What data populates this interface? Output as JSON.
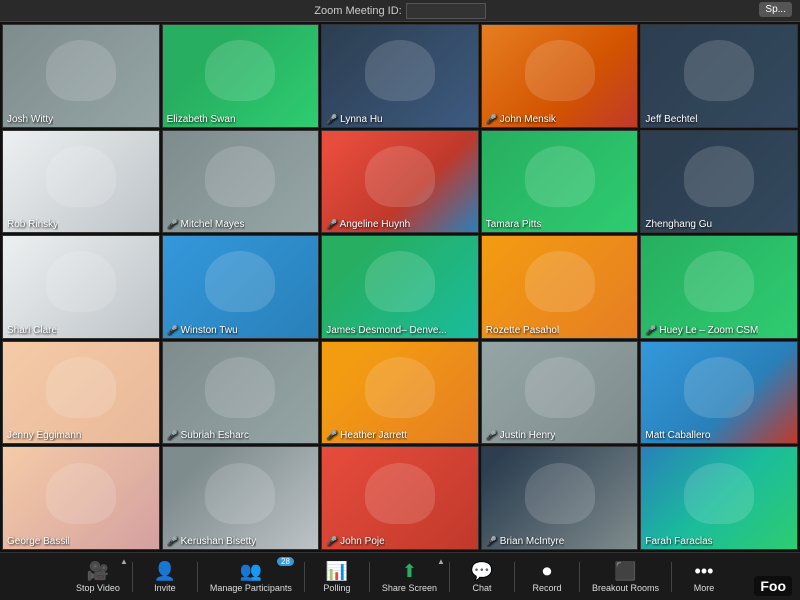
{
  "topbar": {
    "meeting_id_label": "Zoom Meeting ID:",
    "sp_button": "Sp..."
  },
  "participants": [
    {
      "name": "Josh Witty",
      "muted": false,
      "tile_class": "tile-0"
    },
    {
      "name": "Elizabeth Swan",
      "muted": false,
      "tile_class": "tile-1"
    },
    {
      "name": "Lynna Hu",
      "muted": true,
      "tile_class": "tile-2"
    },
    {
      "name": "John Mensik",
      "muted": true,
      "tile_class": "tile-3"
    },
    {
      "name": "Jeff Bechtel",
      "muted": false,
      "tile_class": "tile-4"
    },
    {
      "name": "Rob Rinsky",
      "muted": false,
      "tile_class": "tile-5"
    },
    {
      "name": "Mitchel Mayes",
      "muted": true,
      "tile_class": "tile-6"
    },
    {
      "name": "Angeline Huynh",
      "muted": true,
      "tile_class": "tile-7"
    },
    {
      "name": "Tamara Pitts",
      "muted": false,
      "tile_class": "tile-8"
    },
    {
      "name": "Zhenghang Gu",
      "muted": false,
      "tile_class": "tile-9"
    },
    {
      "name": "Shari Clare",
      "muted": false,
      "tile_class": "tile-10"
    },
    {
      "name": "Winston Twu",
      "muted": true,
      "tile_class": "tile-11"
    },
    {
      "name": "James Desmond– Denve...",
      "muted": false,
      "tile_class": "tile-12"
    },
    {
      "name": "Rozette Pasahol",
      "muted": false,
      "tile_class": "tile-13"
    },
    {
      "name": "Huey Le – Zoom CSM",
      "muted": true,
      "tile_class": "tile-14"
    },
    {
      "name": "Jenny Eggimann",
      "muted": false,
      "tile_class": "tile-15"
    },
    {
      "name": "Subriah Esharc",
      "muted": true,
      "tile_class": "tile-16"
    },
    {
      "name": "Heather Jarrett",
      "muted": true,
      "tile_class": "tile-17"
    },
    {
      "name": "Justin Henry",
      "muted": true,
      "tile_class": "tile-18"
    },
    {
      "name": "Matt Caballero",
      "muted": false,
      "tile_class": "tile-19"
    },
    {
      "name": "George Bassil",
      "muted": false,
      "tile_class": "tile-20"
    },
    {
      "name": "Kerushan Bisetty",
      "muted": true,
      "tile_class": "tile-21"
    },
    {
      "name": "John Poje",
      "muted": true,
      "tile_class": "tile-22"
    },
    {
      "name": "Brian McIntyre",
      "muted": true,
      "tile_class": "tile-23"
    },
    {
      "name": "Farah Faraclas",
      "muted": false,
      "tile_class": "tile-24"
    }
  ],
  "toolbar": {
    "items": [
      {
        "id": "stop-video",
        "icon": "🎥",
        "label": "Stop Video",
        "has_arrow": true,
        "active": false,
        "red": false
      },
      {
        "id": "invite",
        "icon": "👤",
        "label": "Invite",
        "has_arrow": false,
        "active": false,
        "red": false
      },
      {
        "id": "manage-participants",
        "icon": "👥",
        "label": "Manage Participants",
        "has_arrow": false,
        "active": false,
        "red": false,
        "badge": "28"
      },
      {
        "id": "polling",
        "icon": "📊",
        "label": "Polling",
        "has_arrow": false,
        "active": false,
        "red": false
      },
      {
        "id": "share-screen",
        "icon": "⬆",
        "label": "Share Screen",
        "has_arrow": true,
        "active": true,
        "red": false
      },
      {
        "id": "chat",
        "icon": "💬",
        "label": "Chat",
        "has_arrow": false,
        "active": false,
        "red": false
      },
      {
        "id": "record",
        "icon": "⏺",
        "label": "Record",
        "has_arrow": false,
        "active": false,
        "red": false
      },
      {
        "id": "breakout-rooms",
        "icon": "⬛",
        "label": "Breakout Rooms",
        "has_arrow": false,
        "active": false,
        "red": false
      },
      {
        "id": "more",
        "icon": "•••",
        "label": "More",
        "has_arrow": false,
        "active": false,
        "red": false
      }
    ]
  },
  "foo_label": "Foo"
}
